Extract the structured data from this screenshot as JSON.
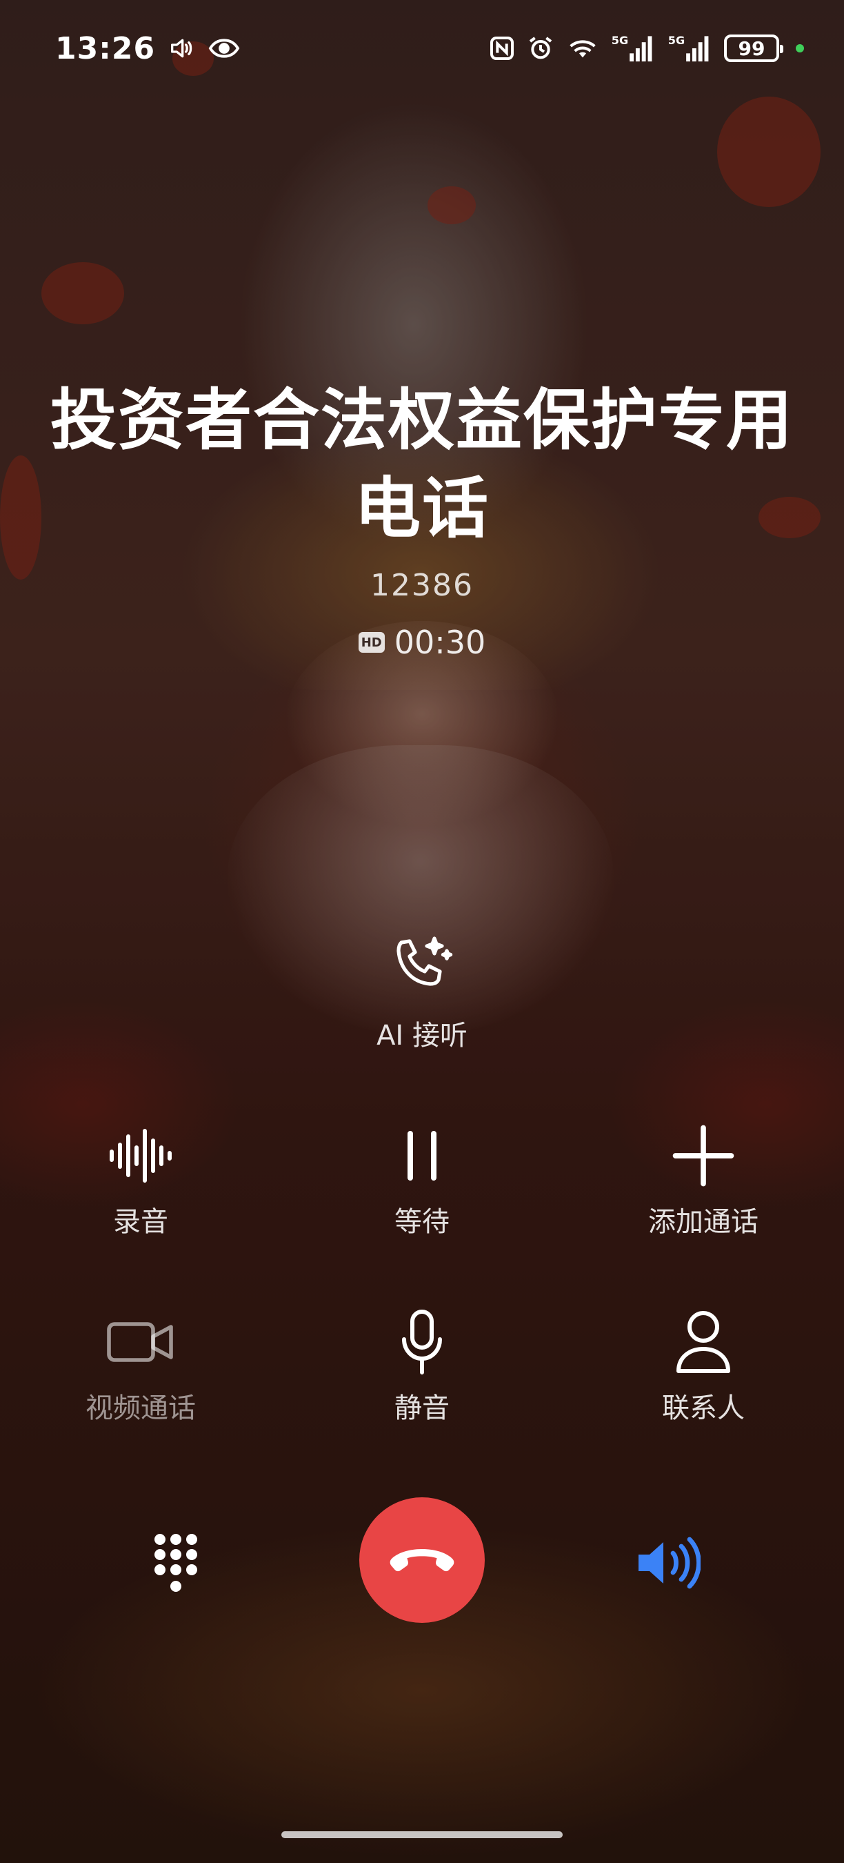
{
  "status_bar": {
    "time": "13:26",
    "battery": "99",
    "network_1": "5G",
    "network_2": "5G"
  },
  "caller": {
    "name": "投资者合法权益保护专用电话",
    "number": "12386",
    "hd_badge": "HD",
    "duration": "00:30"
  },
  "ai_answer": {
    "label": "AI 接听",
    "icon": "phone-sparkle-icon"
  },
  "controls": [
    [
      {
        "label": "录音",
        "icon": "waveform-icon"
      },
      {
        "label": "等待",
        "icon": "pause-icon"
      },
      {
        "label": "添加通话",
        "icon": "plus-icon"
      }
    ],
    [
      {
        "label": "视频通话",
        "icon": "video-camera-icon"
      },
      {
        "label": "静音",
        "icon": "microphone-icon"
      },
      {
        "label": "联系人",
        "icon": "person-icon"
      }
    ]
  ],
  "bottom": {
    "keypad_icon": "dialpad-icon",
    "hangup_icon": "hang-up-icon",
    "speaker_icon": "speaker-icon"
  },
  "colors": {
    "hangup": "#e84545",
    "speaker_active": "#3b82f6",
    "status_dot": "#3fcf5a"
  }
}
